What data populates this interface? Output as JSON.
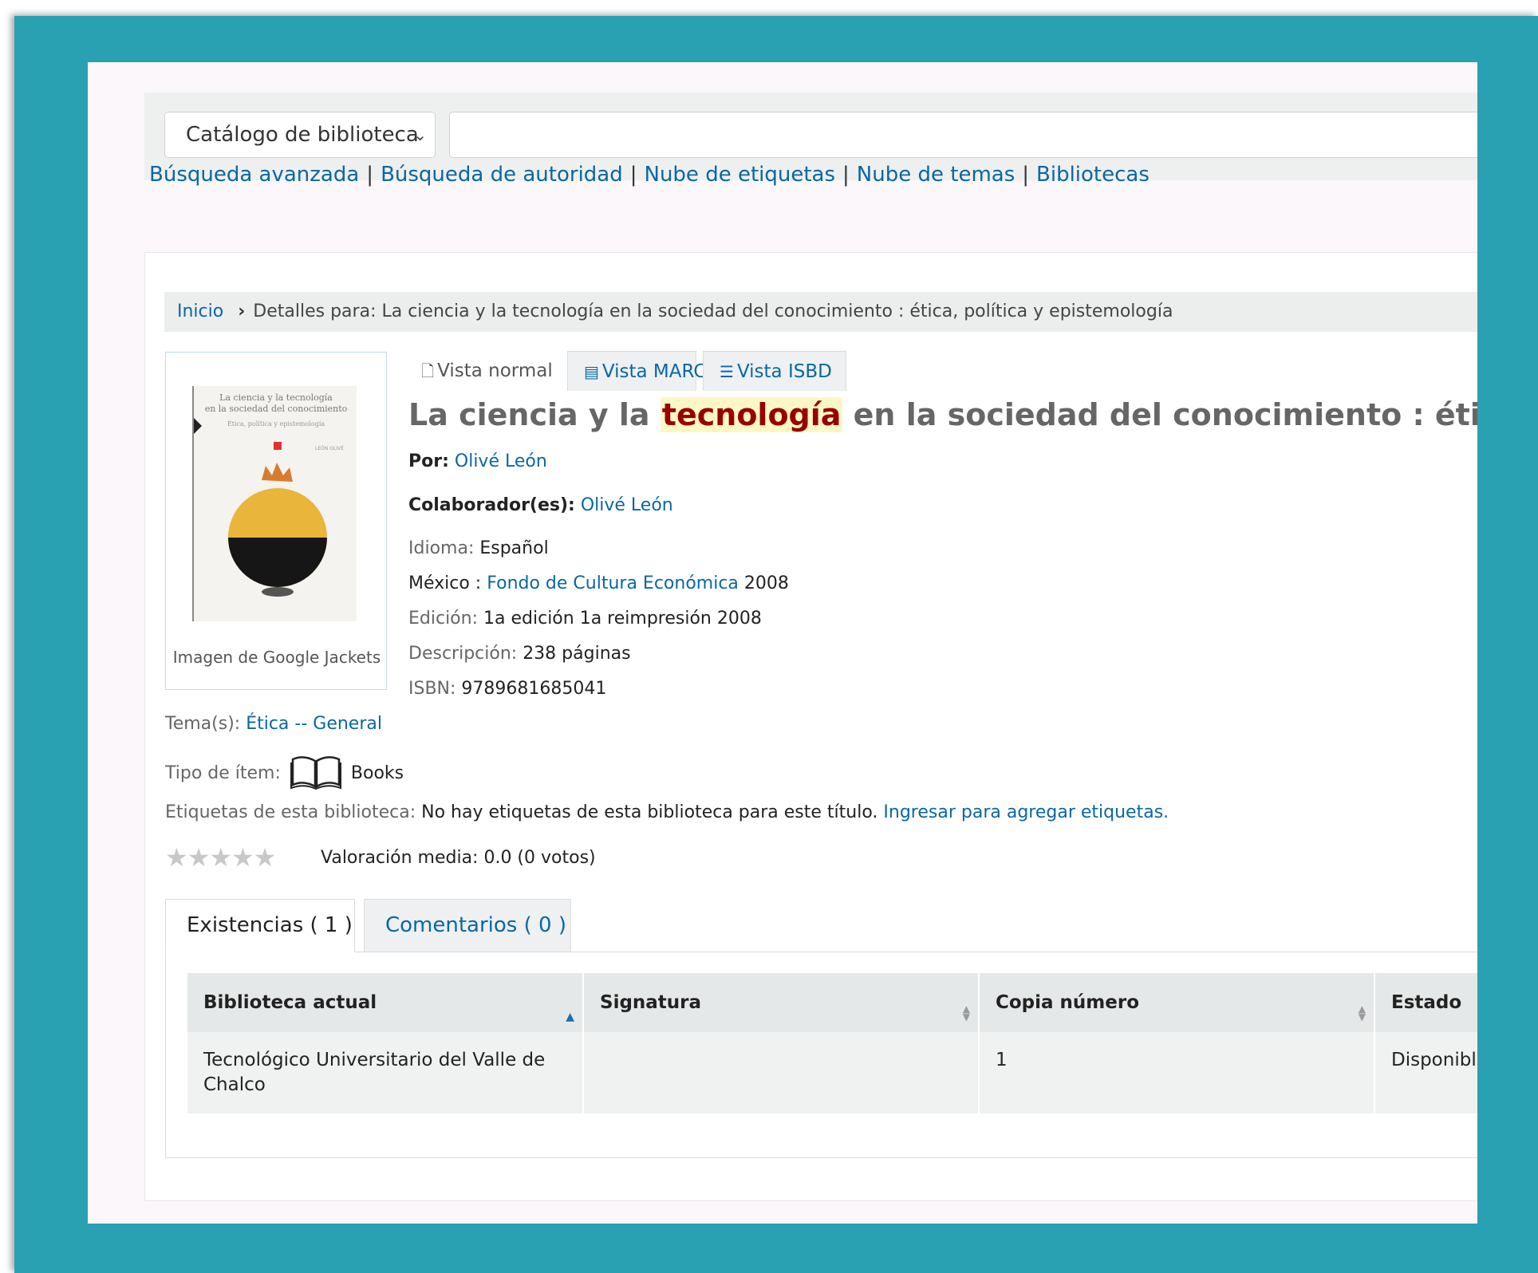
{
  "search": {
    "scope_selected": "Catálogo de biblioteca",
    "query": ""
  },
  "nav_links": [
    "Búsqueda avanzada",
    "Búsqueda de autoridad",
    "Nube de etiquetas",
    "Nube de temas",
    "Bibliotecas"
  ],
  "breadcrumb": {
    "home": "Inicio",
    "current": "Detalles para: La ciencia y la tecnología en la sociedad del conocimiento : ética, política y epistemología"
  },
  "cover": {
    "caption": "Imagen de Google Jackets",
    "line1": "La ciencia y la tecnología",
    "line2": "en la sociedad del conocimiento",
    "line3": "Ética, política y epistemología",
    "author": "LEÓN OLIVÉ"
  },
  "view_tabs": {
    "normal": "Vista normal",
    "marc": "Vista MARC",
    "isbd": "Vista ISBD"
  },
  "record": {
    "title_pre": "La ciencia y la",
    "title_highlight": "tecnología",
    "title_post": "en la sociedad del conocimiento : ética, polít",
    "by_label": "Por:",
    "by_value": "Olivé León",
    "contrib_label": "Colaborador(es):",
    "contrib_value": "Olivé León",
    "lang_label": "Idioma:",
    "lang_value": "Español",
    "pub_place": "México :",
    "publisher": "Fondo de Cultura Económica",
    "pub_year": "2008",
    "edition_label": "Edición:",
    "edition_value": "1a edición 1a reimpresión 2008",
    "desc_label": "Descripción:",
    "desc_value": "238 páginas",
    "isbn_label": "ISBN:",
    "isbn_value": "9789681685041",
    "subject_label": "Tema(s):",
    "subject_value": "Ética -- General",
    "itemtype_label": "Tipo de ítem:",
    "itemtype_value": "Books",
    "tags_label": "Etiquetas de esta biblioteca:",
    "tags_value": "No hay etiquetas de esta biblioteca para este título.",
    "tags_link": "Ingresar para agregar etiquetas.",
    "rating_text": "Valoración media: 0.0 (0 votos)",
    "rating_value": 0
  },
  "detail_tabs": {
    "holdings": "Existencias ( 1 )",
    "comments": "Comentarios ( 0 )"
  },
  "holdings_table": {
    "headers": [
      "Biblioteca actual",
      "Signatura",
      "Copia número",
      "Estado"
    ],
    "rows": [
      {
        "library": "Tecnológico Universitario del Valle de Chalco",
        "callnumber": "",
        "copy": "1",
        "status": "Disponible"
      }
    ]
  },
  "colors": {
    "frame": "#2aa1b3",
    "link": "#0a67a3",
    "highlight_text": "#990000",
    "highlight_bg": "#fdf7c8",
    "available": "#1f7a1f"
  }
}
